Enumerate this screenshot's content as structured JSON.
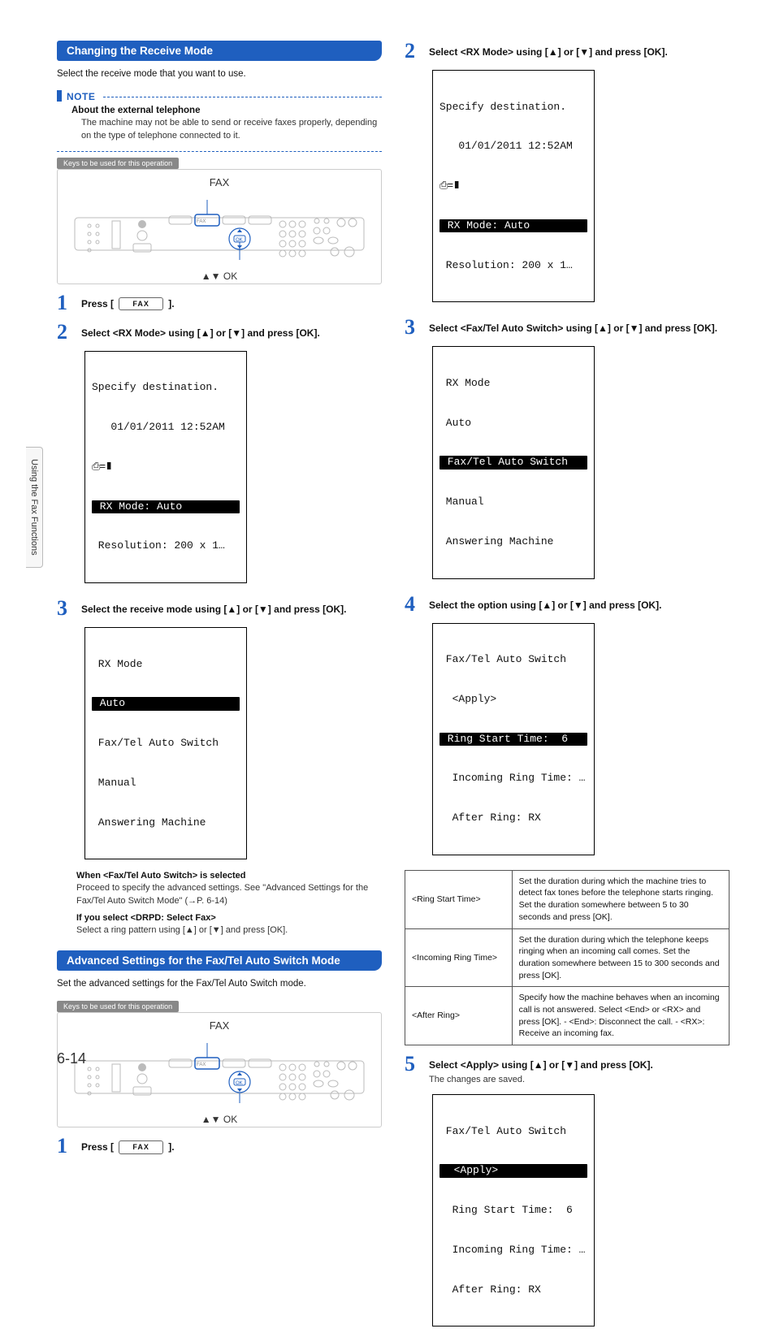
{
  "side_tab": "Using the Fax Functions",
  "page_number": "6-14",
  "glyphs": {
    "up": "▲",
    "down": "▼",
    "ok": "OK"
  },
  "section1": {
    "title": "Changing the Receive Mode",
    "intro": "Select the receive mode that you want to use.",
    "note_label": "NOTE",
    "note_sub": "About the external telephone",
    "note_body": "The machine may not be able to send or receive faxes properly, depending on the type of telephone connected to it.",
    "keys_caption": "Keys to be used for this operation",
    "panel_title": "FAX",
    "panel_footer": "▲▼ OK",
    "steps": {
      "s1": {
        "text_a": "Press [",
        "key": "FAX",
        "text_b": "]."
      },
      "s2": "Select <RX Mode> using [▲] or [▼] and press [OK].",
      "s3": "Select the receive mode using [▲] or [▼] and press [OK]."
    },
    "lcd1": {
      "l1": "Specify destination.",
      "l2": "   01/01/2011 12:52AM",
      "l3_icon": "book",
      "l4": " RX Mode: Auto",
      "l5": " Resolution: 200 x 1…"
    },
    "lcd2": {
      "l1": " RX Mode",
      "l2": " Auto",
      "l3": " Fax/Tel Auto Switch",
      "l4": " Manual",
      "l5": " Answering Machine"
    },
    "when_title": "When <Fax/Tel Auto Switch> is selected",
    "when_body": "Proceed to specify the advanced settings. See \"Advanced Settings for the Fax/Tel Auto Switch Mode\" (→P. 6-14)",
    "drpd_title": "If you select <DRPD: Select Fax>",
    "drpd_body": "Select a ring pattern  using [▲] or [▼] and press [OK]."
  },
  "section2": {
    "title": "Advanced Settings for the Fax/Tel Auto Switch Mode",
    "intro": "Set the advanced settings for the Fax/Tel Auto Switch mode.",
    "keys_caption": "Keys to be used for this operation",
    "panel_title": "FAX",
    "panel_footer": "▲▼ OK",
    "steps": {
      "s1": {
        "text_a": "Press [",
        "key": "FAX",
        "text_b": "]."
      },
      "s2": "Select <RX Mode> using [▲] or [▼] and press [OK].",
      "s3": "Select <Fax/Tel Auto Switch> using [▲] or [▼] and press [OK].",
      "s4": "Select the option using [▲] or [▼] and press [OK].",
      "s5": "Select <Apply> using [▲] or [▼] and press [OK].",
      "s5_sub": "The changes are saved."
    },
    "lcd1": {
      "l1": "Specify destination.",
      "l2": "   01/01/2011 12:52AM",
      "l3_icon": "book",
      "l4": " RX Mode: Auto",
      "l5": " Resolution: 200 x 1…"
    },
    "lcd2": {
      "l1": " RX Mode",
      "l2": " Auto",
      "l3": " Fax/Tel Auto Switch",
      "l4": " Manual",
      "l5": " Answering Machine"
    },
    "lcd3": {
      "l1": " Fax/Tel Auto Switch",
      "l2": "  <Apply>",
      "l3": " Ring Start Time:  6",
      "l4": "  Incoming Ring Time: …",
      "l5": "  After Ring: RX"
    },
    "lcd4": {
      "l1": " Fax/Tel Auto Switch",
      "l2": "  <Apply>",
      "l3": "  Ring Start Time:  6",
      "l4": "  Incoming Ring Time: …",
      "l5": "  After Ring: RX"
    },
    "table": [
      {
        "k": "<Ring Start Time>",
        "v": "Set the duration during which the machine tries to detect fax tones before the telephone starts ringing.\nSet the duration somewhere between 5 to 30 seconds and press [OK]."
      },
      {
        "k": "<Incoming Ring Time>",
        "v": "Set the duration during which the telephone keeps ringing when an incoming call comes.\nSet the duration somewhere between 15 to 300 seconds and press [OK]."
      },
      {
        "k": "<After Ring>",
        "v": "Specify how the machine behaves when an incoming call is not answered.\nSelect <End> or <RX> and press [OK].\n  -  <End>: Disconnect the call.\n  -  <RX>: Receive an incoming fax."
      }
    ]
  }
}
